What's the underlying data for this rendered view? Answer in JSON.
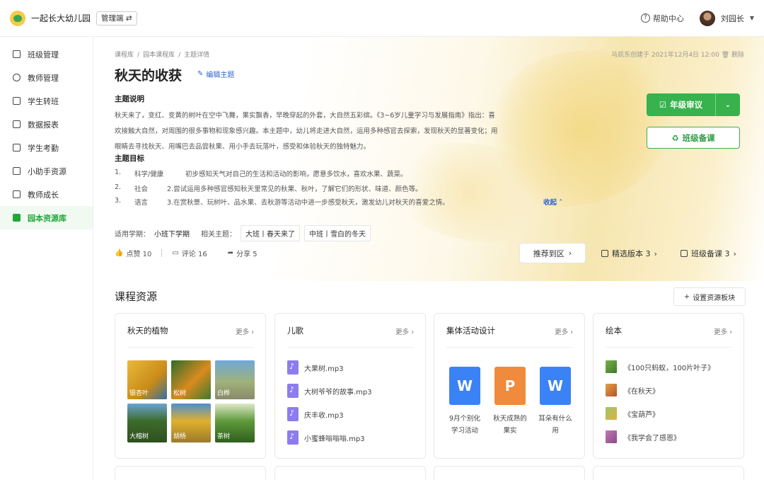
{
  "topbar": {
    "brand": "一起长大幼儿园",
    "role": "管理端 ⇄",
    "help": "帮助中心",
    "user": "刘园长"
  },
  "sidebar": {
    "items": [
      {
        "label": "班级管理"
      },
      {
        "label": "教师管理"
      },
      {
        "label": "学生转班"
      },
      {
        "label": "数据报表"
      },
      {
        "label": "学生考勤"
      },
      {
        "label": "小助手资源"
      },
      {
        "label": "教师成长"
      },
      {
        "label": "园本资源库"
      }
    ]
  },
  "breadcrumb": [
    "课程库",
    "/",
    "园本课程库",
    "/",
    "主题详情"
  ],
  "author": "马凯东创建于 2021年12月4日 12:00   🗑 删除",
  "title": "秋天的收获",
  "edit_label": "编辑主题",
  "desc_heading": "主题说明",
  "desc_lines": [
    "秋天来了，变红、变黄的树叶在空中飞舞，果实飘香，早晚穿起的外套，大自然五彩缤。《3~6岁儿童学习与发展指南》指出：喜",
    "欢接触大自然，对周围的很多事物和现象感兴趣。本主题中，幼儿将走进大自然，运用多种感官去探索，发现秋天的显著变化；用",
    "眼睛去寻找秋天、用嘴巴去品尝秋果、用小手去玩落叶，感受和体验秋天的独特魅力。"
  ],
  "goal_heading": "主题目标",
  "goals": [
    {
      "n": "1.",
      "cat": "科学/健康",
      "text": "初步感知天气对自己的生活和活动的影响，愿意多饮水，喜欢水果、蔬菜。"
    },
    {
      "n": "2.",
      "cat": "社会",
      "text": "2.尝试运用多种感官感知秋天里常见的秋果、秋叶，了解它们的形状、味道、颜色等。"
    },
    {
      "n": "3.",
      "cat": "语言",
      "text": "3.在赏秋景、玩树叶、品水果、去秋游等活动中进一步感受秋天，激发幼儿对秋天的喜爱之情。"
    }
  ],
  "collapse": "收起 ˄",
  "actions": {
    "review": "年级审议",
    "prep": "班级备课"
  },
  "period_label": "适用学期：",
  "period_value": "小班下学期",
  "related_label": "相关主题：",
  "related": [
    "大班丨春天来了",
    "中班丨雪白的冬天"
  ],
  "stats": {
    "likes": "点赞 10",
    "comments": "评论 16",
    "shares": "分享 5"
  },
  "recommend": "推荐到区",
  "featured": "精选版本 3",
  "class_prep": "班级备课 3",
  "resources_title": "课程资源",
  "set_block": "设置资源板块",
  "more": "更多",
  "cards": [
    {
      "title": "秋天的植物",
      "thumbs": [
        "银杏叶",
        "松树",
        "白桦",
        "大榕树",
        "胡杨",
        "茶树"
      ]
    },
    {
      "title": "儿歌",
      "files": [
        "大果树.mp3",
        "大树爷爷的故事.mp3",
        "庆丰收.mp3",
        "小蜜蜂嗡嗡嗡.mp3"
      ]
    },
    {
      "title": "集体活动设计",
      "docs": [
        {
          "letter": "W",
          "color": "#3b82f6",
          "cap1": "9月个别化",
          "cap2": "学习活动"
        },
        {
          "letter": "P",
          "color": "#f08a3c",
          "cap1": "秋天成熟的",
          "cap2": "果实"
        },
        {
          "letter": "W",
          "color": "#3b82f6",
          "cap1": "耳朵有什么",
          "cap2": "用"
        }
      ]
    },
    {
      "title": "绘本",
      "books": [
        "《100只蚂蚁，100片叶子》",
        "《在秋天》",
        "《宝葫芦》",
        "《我学会了感恩》"
      ]
    }
  ]
}
